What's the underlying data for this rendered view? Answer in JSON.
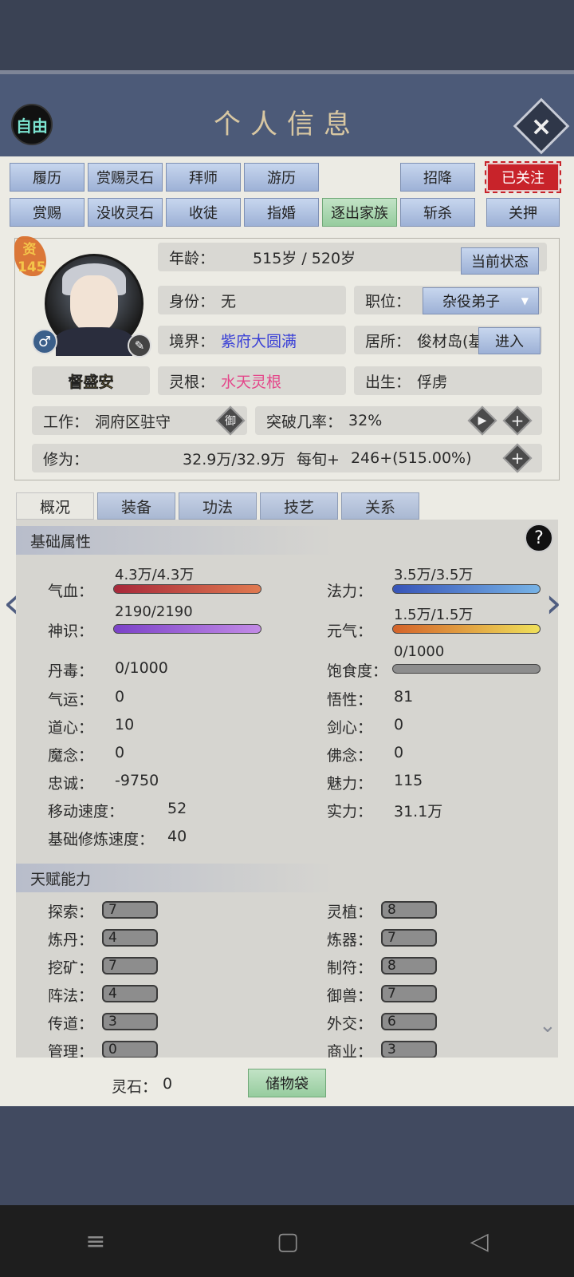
{
  "header": {
    "title": "个人信息",
    "free_label": "自由",
    "close_icon": "×"
  },
  "action_buttons_row1": [
    "履历",
    "赏赐灵石",
    "拜师",
    "游历",
    "招降",
    "已关注"
  ],
  "action_buttons_row2": [
    "赏赐",
    "没收灵石",
    "收徒",
    "指婚",
    "逐出家族",
    "斩杀",
    "关押"
  ],
  "profile": {
    "aptitude_label": "资",
    "aptitude_value": "145",
    "name": "督盛安",
    "gender_icon": "♂",
    "age_label": "年龄：",
    "age_value": "515岁 / 520岁",
    "status_button": "当前状态",
    "identity_label": "身份：",
    "identity_value": "无",
    "position_label": "职位：",
    "position_value": "杂役弟子",
    "realm_label": "境界：",
    "realm_value": "紫府大圆满",
    "residence_label": "居所：",
    "residence_value": "俊材岛(基",
    "enter_button": "进入",
    "root_label": "灵根：",
    "root_value": "水天灵根",
    "birth_label": "出生：",
    "birth_value": "俘虏",
    "work_label": "工作：",
    "work_value": "洞府区驻守",
    "work_icon": "御",
    "breakthrough_label": "突破几率：",
    "breakthrough_value": "32%",
    "cultivation_label": "修为：",
    "cultivation_value": "32.9万/32.9万",
    "per_period_label": "每旬+",
    "per_period_value": "246+(515.00%)"
  },
  "tabs": [
    "概况",
    "装备",
    "功法",
    "技艺",
    "关系"
  ],
  "basic": {
    "title": "基础属性",
    "help_icon": "?",
    "hp_label": "气血：",
    "hp_value": "4.3万/4.3万",
    "hp_ratio": 1.0,
    "mana_label": "法力：",
    "mana_value": "3.5万/3.5万",
    "mana_ratio": 1.0,
    "sense_label": "神识：",
    "sense_value": "2190/2190",
    "sense_ratio": 1.0,
    "vital_label": "元气：",
    "vital_value": "1.5万/1.5万",
    "vital_ratio": 1.0,
    "poison_label": "丹毒：",
    "poison_value": "0/1000",
    "satiety_label": "饱食度：",
    "satiety_value": "0/1000",
    "satiety_ratio": 0.0,
    "luck_label": "气运：",
    "luck_value": "0",
    "comprehension_label": "悟性：",
    "comprehension_value": "81",
    "daoheart_label": "道心：",
    "daoheart_value": "10",
    "swordheart_label": "剑心：",
    "swordheart_value": "0",
    "demon_label": "魔念：",
    "demon_value": "0",
    "buddha_label": "佛念：",
    "buddha_value": "0",
    "loyalty_label": "忠诚：",
    "loyalty_value": "-9750",
    "charm_label": "魅力：",
    "charm_value": "115",
    "speed_label": "移动速度：",
    "speed_value": "52",
    "power_label": "实力：",
    "power_value": "31.1万",
    "train_label": "基础修炼速度：",
    "train_value": "40"
  },
  "talents": {
    "title": "天赋能力",
    "explore_label": "探索：",
    "explore_value": "7",
    "plant_label": "灵植：",
    "plant_value": "8",
    "alchemy_label": "炼丹：",
    "alchemy_value": "4",
    "forge_label": "炼器：",
    "forge_value": "7",
    "mining_label": "挖矿：",
    "mining_value": "7",
    "talisman_label": "制符：",
    "talisman_value": "8",
    "formation_label": "阵法：",
    "formation_value": "4",
    "beast_label": "御兽：",
    "beast_value": "7",
    "teach_label": "传道：",
    "teach_value": "3",
    "diplomacy_label": "外交：",
    "diplomacy_value": "6",
    "manage_label": "管理：",
    "manage_value": "0",
    "commerce_label": "商业：",
    "commerce_value": "3"
  },
  "footer": {
    "stones_label": "灵石：",
    "stones_value": "0",
    "bag_button": "储物袋"
  },
  "colors": {
    "hp": "#c9443f",
    "mana": "#3e63c4",
    "sense": "#8b55d1",
    "vital": "#e0a23a",
    "satiety": "#8d8d8d"
  }
}
